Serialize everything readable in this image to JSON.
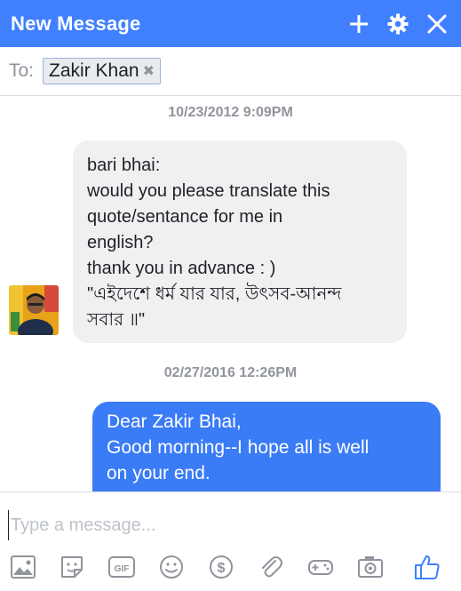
{
  "header": {
    "title": "New Message",
    "icons": [
      "plus-icon",
      "gear-icon",
      "close-icon"
    ]
  },
  "recipients": {
    "to_label": "To:",
    "chips": [
      {
        "name": "Zakir Khan",
        "remove_glyph": "✖"
      }
    ]
  },
  "thread": {
    "messages": [
      {
        "timestamp": "10/23/2012 9:09PM",
        "direction": "incoming",
        "lines": [
          "bari bhai:",
          "would you please translate this",
          "quote/sentance for me in",
          "english?",
          "thank you in advance : )",
          "\"এইদেশে ধর্ম যার যার, উৎসব-আনন্দ",
          "সবার ॥\""
        ]
      },
      {
        "timestamp": "02/27/2016 12:26PM",
        "direction": "outgoing",
        "lines": [
          "Dear Zakir Bhai,",
          "Good morning--I hope all is well",
          "on your end."
        ]
      }
    ]
  },
  "composer": {
    "placeholder": "Type a message...",
    "tools": [
      "photo-icon",
      "sticker-icon",
      "gif-icon",
      "emoji-icon",
      "payment-icon",
      "attachment-icon",
      "game-icon",
      "camera-icon",
      "like-icon"
    ]
  },
  "colors": {
    "header_bg": "#4080ff",
    "outgoing_bubble": "#3a7bf6",
    "incoming_bubble": "#f1f0f0",
    "icon_gray": "#90949c",
    "like_blue": "#4080ff"
  }
}
